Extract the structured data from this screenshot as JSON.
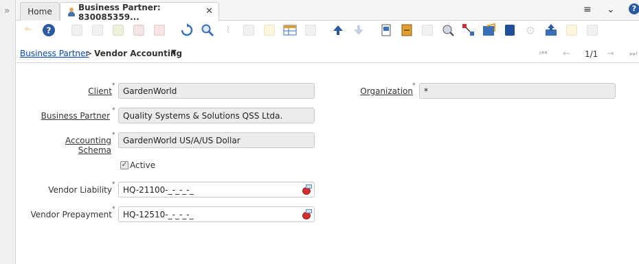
{
  "tabs": {
    "home_label": "Home",
    "active_label": "Business Partner: 830085359..."
  },
  "breadcrumb": {
    "link": "Business Partner",
    "separator": ">",
    "current": "Vendor Accounting",
    "caret": "▼"
  },
  "navigation": {
    "record_count": "1/1"
  },
  "form": {
    "client_label": "Client",
    "client_value": "GardenWorld",
    "organization_label": "Organization",
    "organization_value": "*",
    "business_partner_label": "Business Partner",
    "business_partner_value": "Quality Systems & Solutions QSS Ltda.",
    "accounting_schema_label": "Accounting Schema",
    "accounting_schema_value": "GardenWorld US/A/US Dollar",
    "active_label": "Active",
    "active_checked": true,
    "vendor_liability_label": "Vendor Liability",
    "vendor_liability_value": "HQ-21100-_-_-_-_",
    "vendor_prepayment_label": "Vendor Prepayment",
    "vendor_prepayment_value": "HQ-12510-_-_-_-_",
    "required_marker": "*"
  },
  "icons": {
    "expand": "»",
    "close": "✕",
    "menu": "≡",
    "collapse": "⌄",
    "help": "?",
    "check": "✓",
    "first": "⏮",
    "prev": "←",
    "next": "→",
    "last": "⏭"
  },
  "colors": {
    "link": "#0645ad",
    "field_readonly": "#ececec",
    "field_editable": "#ffffff",
    "toolbar_blue": "#3a6fb5",
    "toolbar_orange": "#e0a030"
  }
}
